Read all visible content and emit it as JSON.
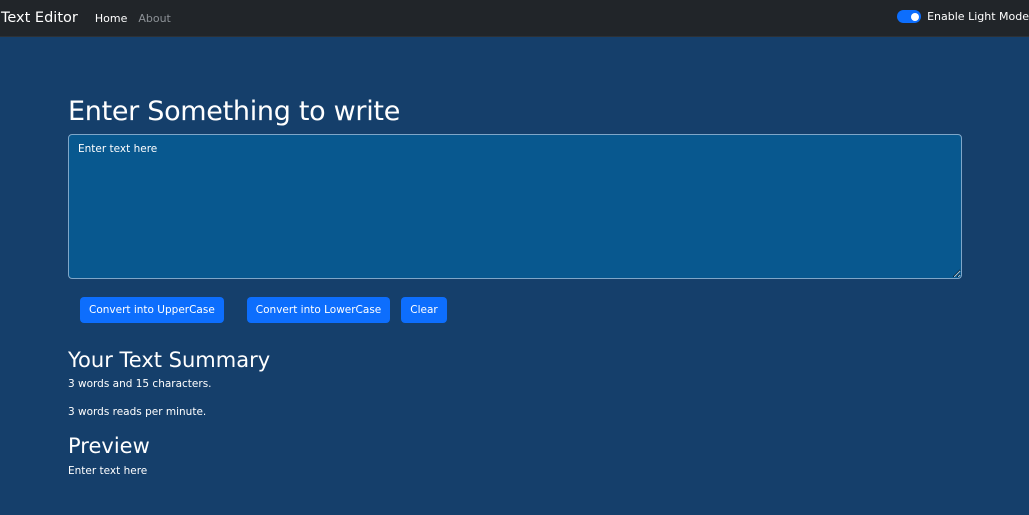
{
  "navbar": {
    "brand": "Text Editor",
    "links": [
      "Home",
      "About"
    ],
    "toggle_label": "Enable Light Mode",
    "toggle_on": true
  },
  "main": {
    "heading": "Enter Something to write",
    "textarea_placeholder": "Enter text here",
    "textarea_value": "",
    "buttons": [
      "Convert into UpperCase",
      "Convert into LowerCase",
      "Clear"
    ],
    "summary_heading": "Your Text Summary",
    "summary_words": "3 words and 15 characters.",
    "summary_read": "3 words reads per minute.",
    "preview_heading": "Preview",
    "preview_text": "Enter text here"
  },
  "colors": {
    "navbar": "#212529",
    "background": "#153f6b",
    "textarea": "#08588f",
    "button": "#0d6efd"
  }
}
